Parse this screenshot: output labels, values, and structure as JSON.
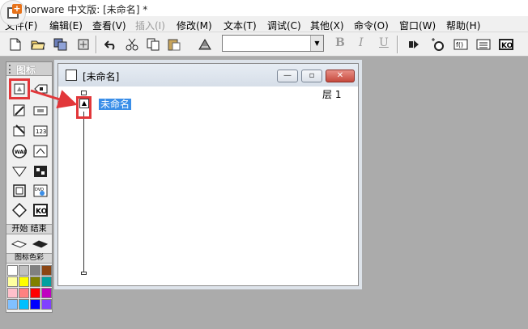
{
  "window": {
    "title": "uthorware 中文版: [未命名] *"
  },
  "menu": [
    {
      "label": "文件(F)",
      "enabled": true
    },
    {
      "label": "编辑(E)",
      "enabled": true
    },
    {
      "label": "查看(V)",
      "enabled": true
    },
    {
      "label": "插入(I)",
      "enabled": false
    },
    {
      "label": "修改(M)",
      "enabled": true
    },
    {
      "label": "文本(T)",
      "enabled": true
    },
    {
      "label": "调试(C)",
      "enabled": true
    },
    {
      "label": "其他(X)",
      "enabled": true
    },
    {
      "label": "命令(O)",
      "enabled": true
    },
    {
      "label": "窗口(W)",
      "enabled": true
    },
    {
      "label": "帮助(H)",
      "enabled": true
    }
  ],
  "toolbar": {
    "buttons": [
      "new-file-icon",
      "open-folder-icon",
      "save-all-icon",
      "import-icon",
      "undo-icon",
      "cut-icon",
      "copy-icon",
      "paste-icon",
      "find-icon"
    ],
    "font_value": "",
    "bold": "B",
    "italic": "I",
    "underline": "U",
    "right_buttons": [
      "run-icon",
      "control-panel-icon",
      "functions-icon",
      "variables-icon",
      "knowledge-objects-icon"
    ]
  },
  "palette": {
    "title": "图标",
    "start_end_label": "开始 结束",
    "color_label": "图标色彩",
    "icons": [
      "display-icon",
      "motion-icon",
      "erase-icon",
      "wait-icon",
      "navigate-icon",
      "framework-icon",
      "decision-icon",
      "interaction-icon",
      "calculation-icon",
      "map-icon",
      "digital-movie-icon",
      "sound-icon",
      "video-icon",
      "knowledge-object-icon",
      "start-flag-icon",
      "end-flag-icon"
    ],
    "colors": [
      "#ffffff",
      "#c0c0c0",
      "#808080",
      "#8b4513",
      "#ffffa0",
      "#ffff00",
      "#808000",
      "#00a0a0",
      "#ffc0cb",
      "#ff8080",
      "#ff0000",
      "#c000c0",
      "#80c0ff",
      "#00c0ff",
      "#0000ff",
      "#8040ff"
    ]
  },
  "flowline_window": {
    "title": "[未命名]",
    "level_label": "层 1",
    "node_label": "未命名"
  },
  "colors": {
    "highlight": "#e2373a",
    "selection": "#3a8ee8"
  }
}
